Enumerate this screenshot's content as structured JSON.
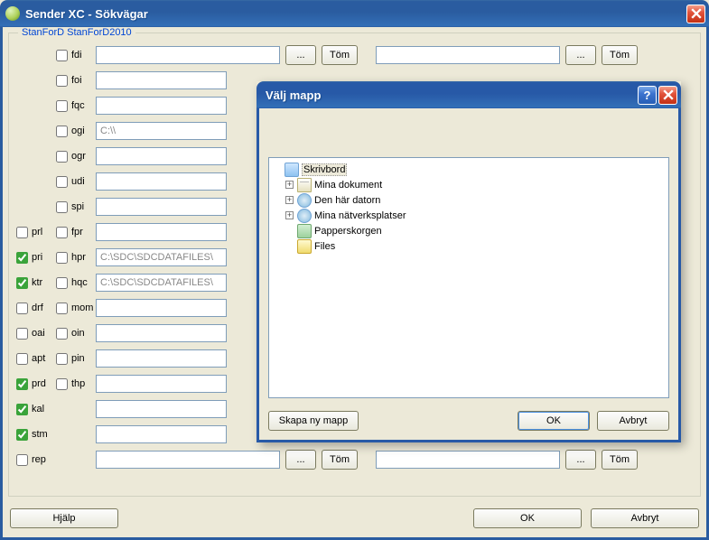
{
  "window": {
    "title": "Sender XC - Sökvägar",
    "group_legend": "StanForD StanForD2010",
    "help": "Hjälp",
    "ok": "OK",
    "cancel": "Avbryt",
    "browse": "...",
    "clear": "Töm"
  },
  "rows": {
    "fdi": {
      "label": "fdi",
      "value": ""
    },
    "foi": {
      "label": "foi",
      "value": ""
    },
    "fqc": {
      "label": "fqc",
      "value": ""
    },
    "ogi": {
      "label": "ogi",
      "value": "C:\\\\"
    },
    "ogr": {
      "label": "ogr",
      "value": ""
    },
    "udi": {
      "label": "udi",
      "value": ""
    },
    "spi": {
      "label": "spi",
      "value": ""
    },
    "prl": {
      "label": "prl"
    },
    "fpr": {
      "label": "fpr",
      "value": ""
    },
    "pri": {
      "label": "pri"
    },
    "hpr": {
      "label": "hpr",
      "value": "C:\\SDC\\SDCDATAFILES\\"
    },
    "ktr": {
      "label": "ktr"
    },
    "hqc": {
      "label": "hqc",
      "value": "C:\\SDC\\SDCDATAFILES\\"
    },
    "drf": {
      "label": "drf"
    },
    "mom": {
      "label": "mom",
      "value": ""
    },
    "oai": {
      "label": "oai"
    },
    "oin": {
      "label": "oin",
      "value": ""
    },
    "apt": {
      "label": "apt"
    },
    "pin": {
      "label": "pin",
      "value": ""
    },
    "prd": {
      "label": "prd"
    },
    "thp": {
      "label": "thp",
      "value": ""
    },
    "kal": {
      "label": "kal",
      "value": ""
    },
    "stm": {
      "label": "stm",
      "value": ""
    },
    "rep": {
      "label": "rep",
      "value": ""
    }
  },
  "checked": {
    "pri": true,
    "ktr": true,
    "prd": true,
    "kal": true,
    "stm": true
  },
  "dialog": {
    "title": "Välj mapp",
    "new_folder": "Skapa ny mapp",
    "ok": "OK",
    "cancel": "Avbryt",
    "tree": {
      "desktop": "Skrivbord",
      "documents": "Mina dokument",
      "computer": "Den här datorn",
      "network": "Mina nätverksplatser",
      "trash": "Papperskorgen",
      "files": "Files"
    }
  }
}
